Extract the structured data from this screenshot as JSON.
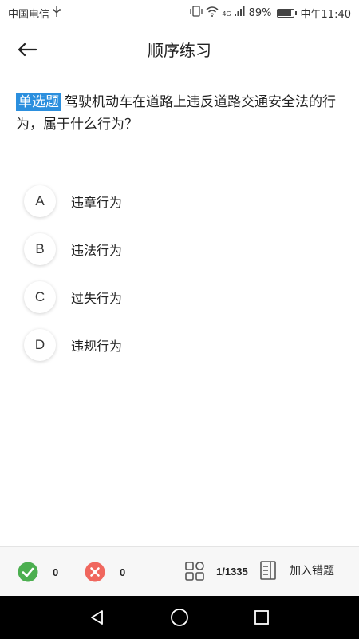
{
  "status_bar": {
    "carrier": "中国电信",
    "network": "4G",
    "battery": "89%",
    "time": "中午11:40"
  },
  "header": {
    "title": "顺序练习"
  },
  "question": {
    "type_label": "单选题",
    "text": "驾驶机动车在道路上违反道路交通安全法的行为，属于什么行为？"
  },
  "options": [
    {
      "letter": "A",
      "text": "违章行为"
    },
    {
      "letter": "B",
      "text": "违法行为"
    },
    {
      "letter": "C",
      "text": "过失行为"
    },
    {
      "letter": "D",
      "text": "违规行为"
    }
  ],
  "bottom_bar": {
    "correct_count": "0",
    "wrong_count": "0",
    "progress": "1/1335",
    "add_wrong_label": "加入错题"
  },
  "colors": {
    "accent": "#2b8fde",
    "correct": "#4caf50",
    "wrong": "#f0675e"
  }
}
